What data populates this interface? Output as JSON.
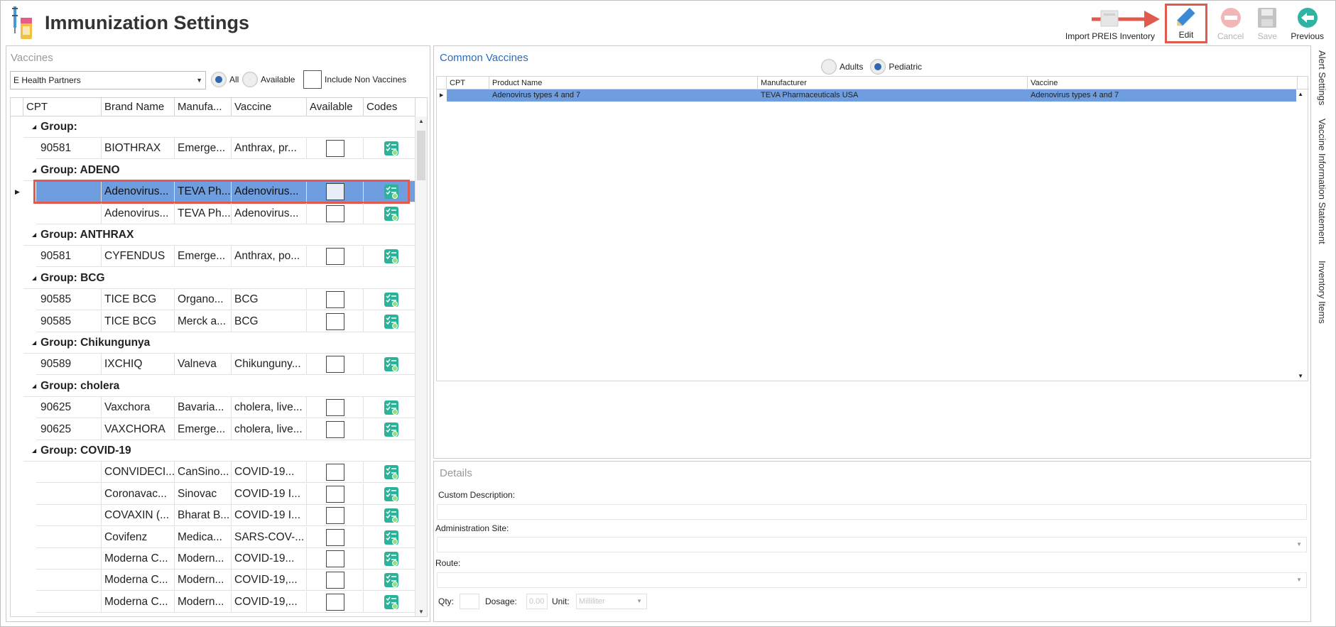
{
  "app": {
    "title": "Immunization Settings"
  },
  "toolbar": {
    "import_label": "Import PREIS Inventory",
    "edit_label": "Edit",
    "cancel_label": "Cancel",
    "save_label": "Save",
    "previous_label": "Previous"
  },
  "vaccines": {
    "title": "Vaccines",
    "partner": "E Health Partners",
    "all_label": "All",
    "available_label": "Available",
    "include_label": "Include Non Vaccines",
    "columns": [
      "CPT",
      "Brand Name",
      "Manufa...",
      "Vaccine",
      "Available",
      "Codes"
    ],
    "rows": [
      {
        "kind": "group",
        "label": "Group:"
      },
      {
        "kind": "item",
        "cpt": "90581",
        "brand": "BIOTHRAX",
        "manu": "Emerge...",
        "vaccine": "Anthrax, pr...",
        "available": false
      },
      {
        "kind": "group",
        "label": "Group: ADENO"
      },
      {
        "kind": "item",
        "cpt": "",
        "brand": "Adenovirus...",
        "manu": "TEVA Ph...",
        "vaccine": "Adenovirus...",
        "available": false,
        "selected": true
      },
      {
        "kind": "item",
        "cpt": "",
        "brand": "Adenovirus...",
        "manu": "TEVA Ph...",
        "vaccine": "Adenovirus...",
        "available": false
      },
      {
        "kind": "group",
        "label": "Group: ANTHRAX"
      },
      {
        "kind": "item",
        "cpt": "90581",
        "brand": "CYFENDUS",
        "manu": "Emerge...",
        "vaccine": "Anthrax, po...",
        "available": false
      },
      {
        "kind": "group",
        "label": "Group: BCG"
      },
      {
        "kind": "item",
        "cpt": "90585",
        "brand": "TICE BCG",
        "manu": "Organo...",
        "vaccine": "BCG",
        "available": false
      },
      {
        "kind": "item",
        "cpt": "90585",
        "brand": "TICE BCG",
        "manu": "Merck a...",
        "vaccine": "BCG",
        "available": false
      },
      {
        "kind": "group",
        "label": "Group: Chikungunya"
      },
      {
        "kind": "item",
        "cpt": "90589",
        "brand": "IXCHIQ",
        "manu": "Valneva",
        "vaccine": "Chikunguny...",
        "available": false
      },
      {
        "kind": "group",
        "label": "Group: cholera"
      },
      {
        "kind": "item",
        "cpt": "90625",
        "brand": "Vaxchora",
        "manu": "Bavaria...",
        "vaccine": "cholera, live...",
        "available": false
      },
      {
        "kind": "item",
        "cpt": "90625",
        "brand": "VAXCHORA",
        "manu": "Emerge...",
        "vaccine": "cholera, live...",
        "available": false
      },
      {
        "kind": "group",
        "label": "Group: COVID-19"
      },
      {
        "kind": "item",
        "cpt": "",
        "brand": "CONVIDECI...",
        "manu": "CanSino...",
        "vaccine": "COVID-19...",
        "available": false
      },
      {
        "kind": "item",
        "cpt": "",
        "brand": "Coronavac...",
        "manu": "Sinovac",
        "vaccine": "COVID-19 I...",
        "available": false
      },
      {
        "kind": "item",
        "cpt": "",
        "brand": "COVAXIN (...",
        "manu": "Bharat B...",
        "vaccine": "COVID-19 I...",
        "available": false
      },
      {
        "kind": "item",
        "cpt": "",
        "brand": "Covifenz",
        "manu": "Medica...",
        "vaccine": "SARS-COV-...",
        "available": false
      },
      {
        "kind": "item",
        "cpt": "",
        "brand": "Moderna C...",
        "manu": "Modern...",
        "vaccine": "COVID-19...",
        "available": false
      },
      {
        "kind": "item",
        "cpt": "",
        "brand": "Moderna C...",
        "manu": "Modern...",
        "vaccine": "COVID-19,...",
        "available": false
      },
      {
        "kind": "item",
        "cpt": "",
        "brand": "Moderna C...",
        "manu": "Modern...",
        "vaccine": "COVID-19,...",
        "available": false
      }
    ]
  },
  "common": {
    "title": "Common Vaccines",
    "adults_label": "Adults",
    "pediatric_label": "Pediatric",
    "columns": [
      "CPT",
      "Product Name",
      "Manufacturer",
      "Vaccine"
    ],
    "rows": [
      {
        "cpt": "",
        "product": "Adenovirus types 4 and 7",
        "manufacturer": "TEVA Pharmaceuticals USA",
        "vaccine": "Adenovirus types 4 and 7"
      }
    ]
  },
  "details": {
    "title": "Details",
    "custom_label": "Custom Description:",
    "site_label": "Administration Site:",
    "route_label": "Route:",
    "qty_label": "Qty:",
    "dosage_label": "Dosage:",
    "dosage_value": "0.00",
    "unit_label": "Unit:",
    "unit_value": "Milliliter"
  },
  "side_tabs": [
    "Alert Settings",
    "Vaccine Information Statement",
    "Inventory Items"
  ],
  "colors": {
    "accent": "#2f67b1",
    "selection": "#6f9ee0",
    "highlight": "#e05a4e",
    "codes_icon": "#2bb39a"
  }
}
